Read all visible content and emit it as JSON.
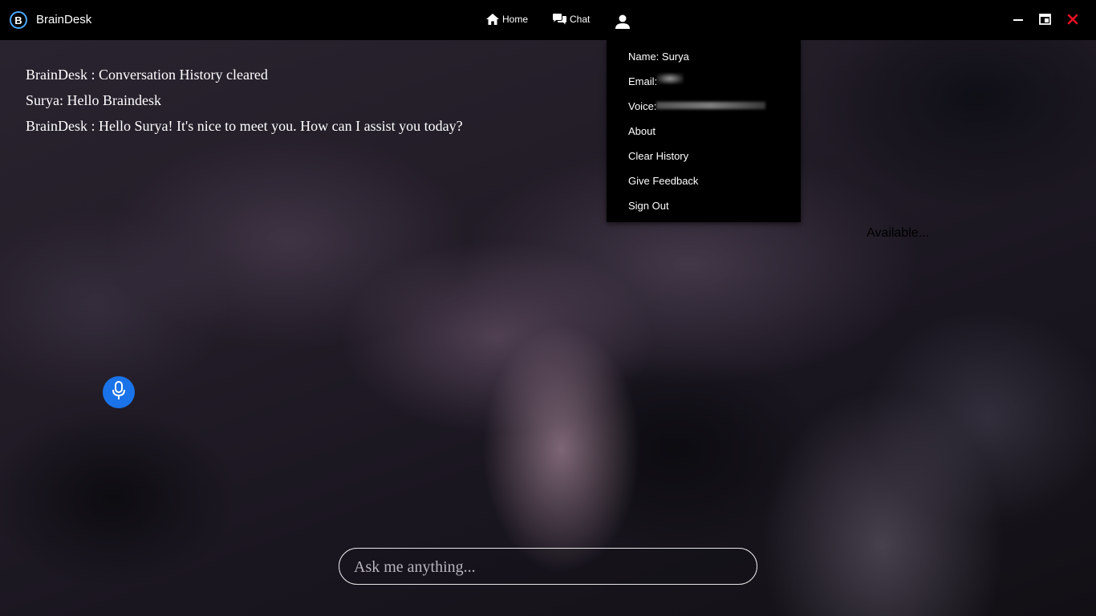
{
  "app": {
    "title": "BrainDesk",
    "logo_letter": "B",
    "accent_color": "#4aa8ff"
  },
  "nav": {
    "home_label": "Home",
    "home_icon": "home-icon",
    "chat_label": "Chat",
    "chat_icon": "chat-icon",
    "user_icon": "user-icon"
  },
  "window_controls": {
    "minimize_icon": "minimize-icon",
    "restore_icon": "restore-icon",
    "close_icon": "close-icon",
    "close_color": "#e81123"
  },
  "messages": [
    "BrainDesk : Conversation History cleared",
    "Surya: Hello Braindesk",
    "BrainDesk : Hello Surya! It's nice to meet you. How can I assist you today?"
  ],
  "profile_menu": {
    "name": "Name: Surya",
    "email_label": "Email:",
    "voice_label": "Voice:",
    "about": "About",
    "clear_history": "Clear History",
    "give_feedback": "Give Feedback",
    "sign_out": "Sign Out"
  },
  "status": "Available...",
  "mic": {
    "icon": "microphone-icon",
    "color": "#1a73e8"
  },
  "input": {
    "placeholder": "Ask me anything...",
    "value": ""
  }
}
